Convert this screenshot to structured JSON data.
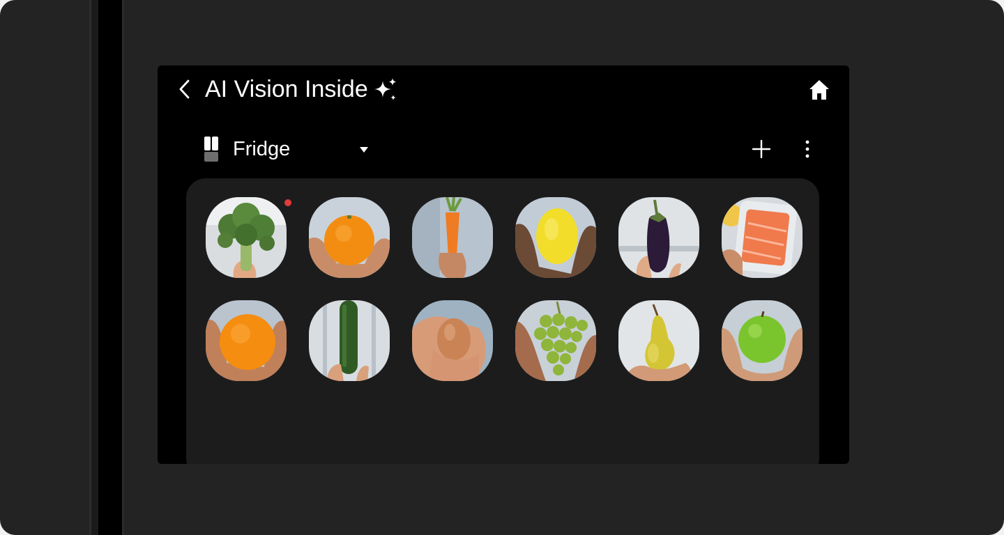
{
  "app": {
    "title": "AI Vision Inside",
    "device_selector": {
      "selected": "Fridge"
    }
  },
  "icons": {
    "back": "chevron-left-icon",
    "sparkle": "sparkle-icon",
    "home": "home-icon",
    "fridge": "fridge-icon",
    "dropdown": "caret-down-icon",
    "add": "plus-icon",
    "more": "more-vertical-icon"
  },
  "colors": {
    "screen_bg": "#000000",
    "panel_bg": "#1c1c1c",
    "badge": "#e23b3b",
    "text": "#ffffff"
  },
  "food_items": [
    {
      "name": "broccoli",
      "has_badge": true
    },
    {
      "name": "orange",
      "has_badge": false
    },
    {
      "name": "carrot",
      "has_badge": false
    },
    {
      "name": "lemon",
      "has_badge": false
    },
    {
      "name": "eggplant",
      "has_badge": false
    },
    {
      "name": "salmon",
      "has_badge": false
    },
    {
      "name": "orange",
      "has_badge": false
    },
    {
      "name": "cucumber",
      "has_badge": false
    },
    {
      "name": "egg",
      "has_badge": false
    },
    {
      "name": "grapes",
      "has_badge": false
    },
    {
      "name": "pear",
      "has_badge": false
    },
    {
      "name": "apple",
      "has_badge": false
    }
  ]
}
